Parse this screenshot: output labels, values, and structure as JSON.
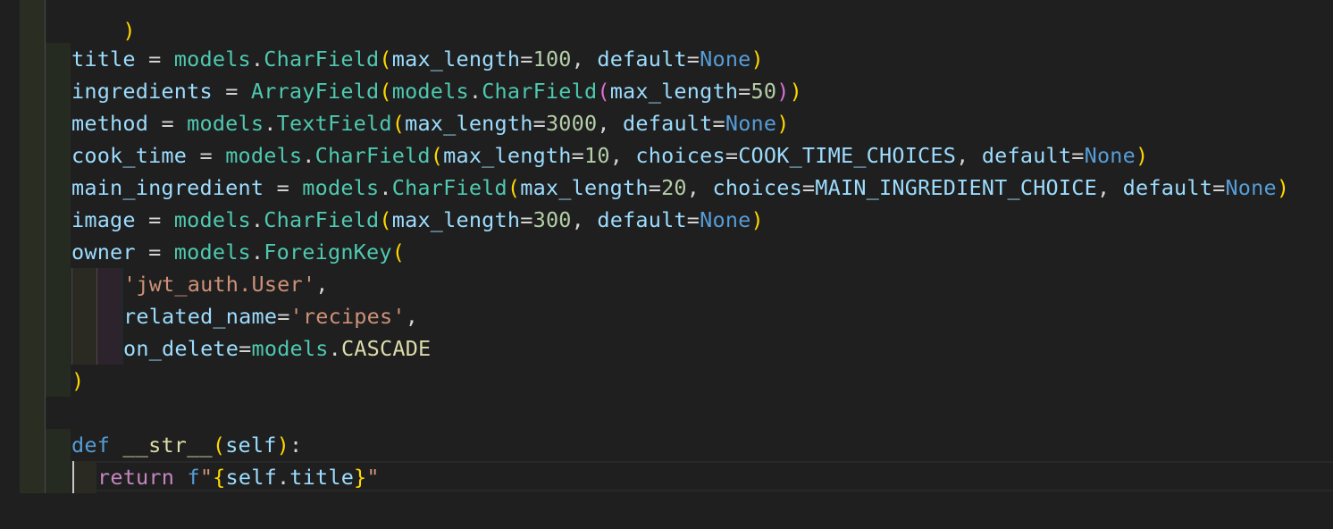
{
  "code": {
    "line0": ")",
    "title_line": {
      "var": "title",
      "eq": " = ",
      "mod": "models",
      "dot": ".",
      "cls": "CharField",
      "open": "(",
      "p1": "max_length",
      "e1": "=",
      "n1": "100",
      "c1": ", ",
      "p2": "default",
      "e2": "=",
      "k": "None",
      "close": ")"
    },
    "ingredients_line": {
      "var": "ingredients",
      "eq": " = ",
      "cls1": "ArrayField",
      "open1": "(",
      "mod": "models",
      "dot": ".",
      "cls2": "CharField",
      "open2": "(",
      "p1": "max_length",
      "e1": "=",
      "n1": "50",
      "close2": ")",
      "close1": ")"
    },
    "method_line": {
      "var": "method",
      "eq": " = ",
      "mod": "models",
      "dot": ".",
      "cls": "TextField",
      "open": "(",
      "p1": "max_length",
      "e1": "=",
      "n1": "3000",
      "c1": ", ",
      "p2": "default",
      "e2": "=",
      "k": "None",
      "close": ")"
    },
    "cook_line": {
      "var": "cook_time",
      "eq": " = ",
      "mod": "models",
      "dot": ".",
      "cls": "CharField",
      "open": "(",
      "p1": "max_length",
      "e1": "=",
      "n1": "10",
      "c1": ", ",
      "p2": "choices",
      "e2": "=",
      "v2": "COOK_TIME_CHOICES",
      "c2": ", ",
      "p3": "default",
      "e3": "=",
      "k": "None",
      "close": ")"
    },
    "main_line": {
      "var": "main_ingredient",
      "eq": " = ",
      "mod": "models",
      "dot": ".",
      "cls": "CharField",
      "open": "(",
      "p1": "max_length",
      "e1": "=",
      "n1": "20",
      "c1": ", ",
      "p2": "choices",
      "e2": "=",
      "v2": "MAIN_INGREDIENT_CHOICE",
      "c2": ", ",
      "p3": "default",
      "e3": "=",
      "k": "None",
      "close": ")"
    },
    "image_line": {
      "var": "image",
      "eq": " = ",
      "mod": "models",
      "dot": ".",
      "cls": "CharField",
      "open": "(",
      "p1": "max_length",
      "e1": "=",
      "n1": "300",
      "c1": ", ",
      "p2": "default",
      "e2": "=",
      "k": "None",
      "close": ")"
    },
    "owner_line": {
      "var": "owner",
      "eq": " = ",
      "mod": "models",
      "dot": ".",
      "cls": "ForeignKey",
      "open": "("
    },
    "arg1_line": {
      "str": "'jwt_auth.User'",
      "comma": ","
    },
    "arg2_line": {
      "p": "related_name",
      "e": "=",
      "str": "'recipes'",
      "comma": ","
    },
    "arg3_line": {
      "p": "on_delete",
      "e": "=",
      "mod": "models",
      "dot": ".",
      "val": "CASCADE"
    },
    "close_line": ")",
    "def_line": {
      "kw": "def",
      "sp": " ",
      "fn": "__str__",
      "open": "(",
      "self": "self",
      "close": ")",
      "colon": ":"
    },
    "return_line": {
      "kw": "return",
      "sp": " ",
      "f": "f",
      "q1": "\"",
      "lb": "{",
      "self": "self",
      "dot": ".",
      "attr": "title",
      "rb": "}",
      "q2": "\""
    }
  }
}
